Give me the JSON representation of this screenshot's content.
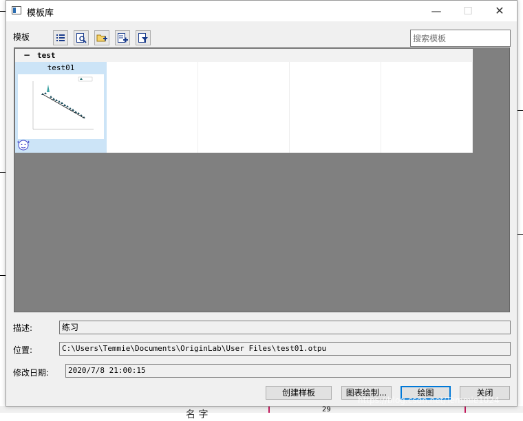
{
  "window": {
    "title": "模板库"
  },
  "toolbar": {
    "label": "模板",
    "icons": [
      "list-view-icon",
      "preview-icon",
      "new-folder-icon",
      "add-template-icon",
      "filter-icon"
    ]
  },
  "search": {
    "placeholder": "搜索模板"
  },
  "gallery": {
    "group": {
      "name": "test",
      "collapse_symbol": "−"
    },
    "templates": [
      {
        "name": "test01",
        "selected": true
      },
      {
        "name": "",
        "selected": false
      },
      {
        "name": "",
        "selected": false
      },
      {
        "name": "",
        "selected": false
      },
      {
        "name": "",
        "selected": false
      }
    ]
  },
  "info": {
    "description_label": "描述:",
    "description_value": "练习",
    "location_label": "位置:",
    "location_value": "C:\\Users\\Temmie\\Documents\\OriginLab\\User Files\\test01.otpu",
    "modified_label": "修改日期:",
    "modified_value": "2020/7/8 21:00:15"
  },
  "buttons": {
    "create": "创建样板",
    "chart_draw": "图表绘制...",
    "plot": "绘图",
    "close": "关闭"
  },
  "background": {
    "fragment_text": "名 字",
    "fragment_number": "29"
  },
  "watermark": "https://blog.csdn.net/Temmie1024",
  "colors": {
    "accent": "#0078d7",
    "gallery_bg": "#808080",
    "selection": "#cce4f7"
  }
}
